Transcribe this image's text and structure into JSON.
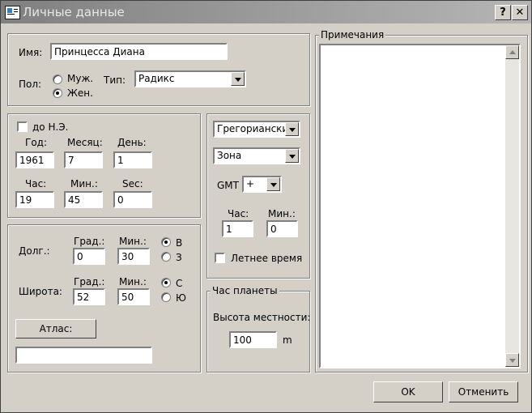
{
  "window": {
    "title": "Личные данные",
    "help_label": "?",
    "close_label": "✕"
  },
  "person": {
    "name_label": "Имя:",
    "name_value": "Принцесса Диана",
    "sex_label": "Пол:",
    "sex_male": "Муж.",
    "sex_female": "Жен.",
    "sex_selected": "Жен.",
    "type_label": "Тип:",
    "type_value": "Радикс"
  },
  "date": {
    "bc_label": "до Н.Э.",
    "bc_checked": false,
    "year_label": "Год:",
    "year_value": "1961",
    "month_label": "Месяц:",
    "month_value": "7",
    "day_label": "День:",
    "day_value": "1",
    "hour_label": "Час:",
    "hour_value": "19",
    "min_label": "Мин.:",
    "min_value": "45",
    "sec_label": "Sec:",
    "sec_value": "0"
  },
  "calendar": {
    "calendar_value": "Грегорианский",
    "zone_value": "Зона",
    "gmt_label": "GMT",
    "gmt_sign": "+",
    "hour_label": "Час:",
    "hour_value": "1",
    "min_label": "Мин.:",
    "min_value": "0",
    "dst_label": "Летнее время",
    "dst_checked": false
  },
  "location": {
    "long_label": "Долг.:",
    "deg_label": "Град.:",
    "min_label": "Мин.:",
    "long_deg": "0",
    "long_min": "30",
    "east": "В",
    "west": "З",
    "long_selected": "В",
    "lat_label": "Широта:",
    "lat_deg": "52",
    "lat_min": "50",
    "north": "С",
    "south": "Ю",
    "lat_selected": "С",
    "atlas_button": "Атлас:",
    "atlas_value": ""
  },
  "planet_hour": {
    "legend": "Час планеты",
    "altitude_label": "Высота местности:",
    "altitude_value": "100",
    "unit": "m"
  },
  "notes": {
    "legend": "Примечания",
    "value": ""
  },
  "footer": {
    "ok": "OK",
    "cancel": "Отменить"
  }
}
